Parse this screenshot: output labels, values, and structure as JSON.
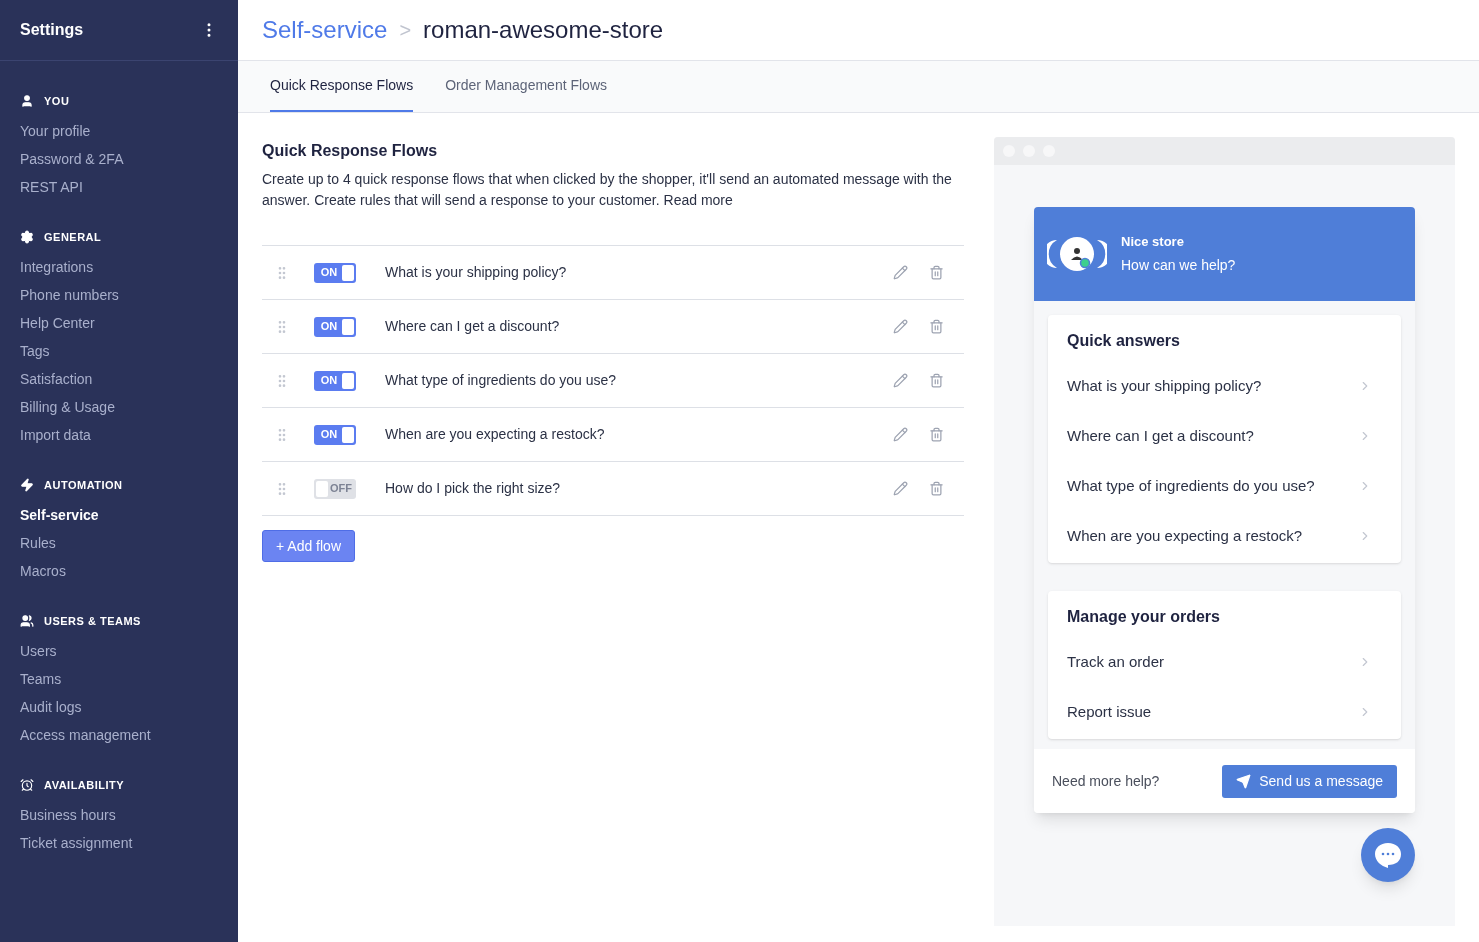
{
  "sidebar": {
    "title": "Settings",
    "sections": [
      {
        "kind": "user",
        "heading": "YOU",
        "items": [
          {
            "label": "Your profile",
            "selected": false
          },
          {
            "label": "Password & 2FA",
            "selected": false
          },
          {
            "label": "REST API",
            "selected": false
          }
        ]
      },
      {
        "kind": "gear",
        "heading": "GENERAL",
        "items": [
          {
            "label": "Integrations",
            "selected": false
          },
          {
            "label": "Phone numbers",
            "selected": false
          },
          {
            "label": "Help Center",
            "selected": false
          },
          {
            "label": "Tags",
            "selected": false
          },
          {
            "label": "Satisfaction",
            "selected": false
          },
          {
            "label": "Billing & Usage",
            "selected": false
          },
          {
            "label": "Import data",
            "selected": false
          }
        ]
      },
      {
        "kind": "bolt",
        "heading": "AUTOMATION",
        "items": [
          {
            "label": "Self-service",
            "selected": true
          },
          {
            "label": "Rules",
            "selected": false
          },
          {
            "label": "Macros",
            "selected": false
          }
        ]
      },
      {
        "kind": "users",
        "heading": "USERS & TEAMS",
        "items": [
          {
            "label": "Users",
            "selected": false
          },
          {
            "label": "Teams",
            "selected": false
          },
          {
            "label": "Audit logs",
            "selected": false
          },
          {
            "label": "Access management",
            "selected": false
          }
        ]
      },
      {
        "kind": "alarm",
        "heading": "AVAILABILITY",
        "items": [
          {
            "label": "Business hours",
            "selected": false
          },
          {
            "label": "Ticket assignment",
            "selected": false
          }
        ]
      }
    ]
  },
  "breadcrumb": {
    "parent": "Self-service",
    "separator": ">",
    "current": "roman-awesome-store"
  },
  "tabs": [
    {
      "label": "Quick Response Flows",
      "selected": true
    },
    {
      "label": "Order Management Flows",
      "selected": false
    }
  ],
  "section": {
    "title": "Quick Response Flows",
    "description": "Create up to 4 quick response flows that when clicked by the shopper, it'll send an automated message with the answer. Create rules that will send a response to your customer.",
    "link": "Read more"
  },
  "flows": [
    {
      "on": true,
      "toggle_label": "ON",
      "question": "What is your shipping policy?"
    },
    {
      "on": true,
      "toggle_label": "ON",
      "question": "Where can I get a discount?"
    },
    {
      "on": true,
      "toggle_label": "ON",
      "question": "What type of ingredients do you use?"
    },
    {
      "on": true,
      "toggle_label": "ON",
      "question": "When are you expecting a restock?"
    },
    {
      "on": false,
      "toggle_label": "OFF",
      "question": "How do I pick the right size?"
    }
  ],
  "add_button": "+ Add flow",
  "preview": {
    "store_name": "Nice store",
    "greeting": "How can we help?",
    "cards": [
      {
        "title": "Quick answers",
        "items": [
          "What is your shipping policy?",
          "Where can I get a discount?",
          "What type of ingredients do you use?",
          "When are you expecting a restock?"
        ]
      },
      {
        "title": "Manage your orders",
        "items": [
          "Track an order",
          "Report issue"
        ]
      }
    ],
    "help_text": "Need more help?",
    "send_button": "Send us a message"
  }
}
